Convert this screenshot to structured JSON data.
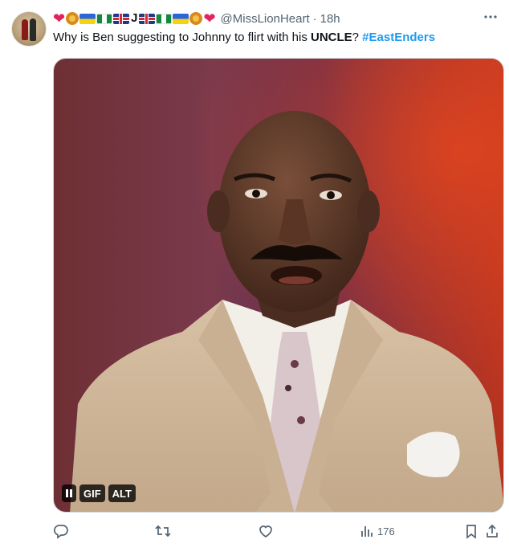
{
  "tweet": {
    "handle": "@MissLionHeart",
    "separator": "·",
    "time": "18h",
    "text_prefix": "Why is Ben suggesting to Johnny to flirt with his ",
    "text_bold": "UNCLE",
    "text_mid": "? ",
    "hashtag": "#EastEnders",
    "display_name_letter": "J"
  },
  "media": {
    "pause_label": "",
    "gif_label": "GIF",
    "alt_label": "ALT"
  },
  "actions": {
    "views_count": "176"
  },
  "icons": {
    "more": "more-icon",
    "reply": "reply-icon",
    "retweet": "retweet-icon",
    "like": "like-icon",
    "views": "views-icon",
    "bookmark": "bookmark-icon",
    "share": "share-icon"
  },
  "colors": {
    "accent": "#1d9bf0",
    "muted": "#536471",
    "heart": "#e0245e"
  }
}
